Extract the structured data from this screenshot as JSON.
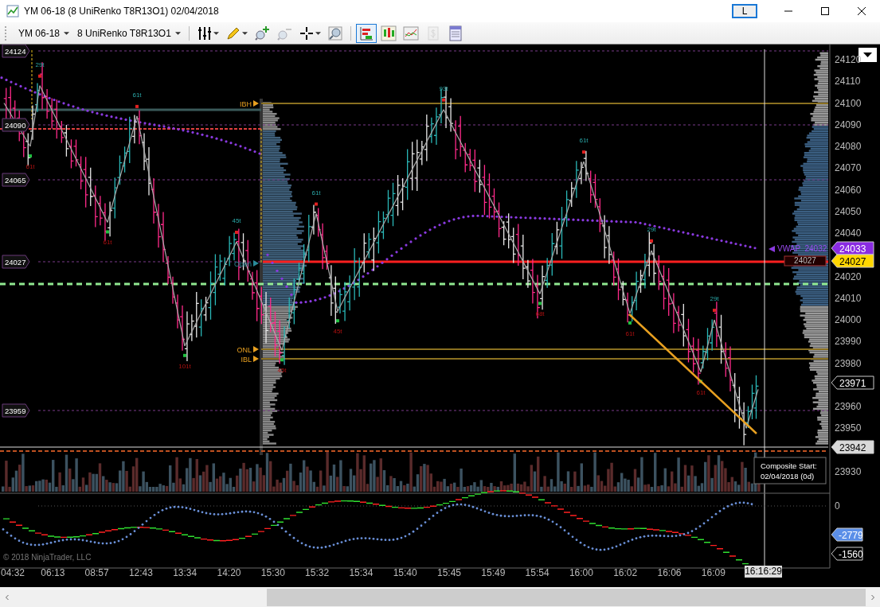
{
  "window": {
    "title": "YM 06-18 (8 UniRenko T8R13O1)  02/04/2018",
    "link_button": "L"
  },
  "toolbar": {
    "instrument": "YM 06-18",
    "bar_type": "8 UniRenko T8R13O1",
    "tools": [
      {
        "kind": "properties",
        "selected": false,
        "disabled": false
      },
      {
        "kind": "pencil",
        "selected": false,
        "disabled": false
      },
      {
        "kind": "zoomin",
        "selected": false,
        "disabled": false
      },
      {
        "kind": "zoomout",
        "selected": false,
        "disabled": true
      },
      {
        "kind": "crosshair",
        "selected": false,
        "disabled": false
      },
      {
        "kind": "magnifier",
        "selected": false,
        "disabled": false
      },
      {
        "kind": "trader",
        "selected": true,
        "disabled": false
      },
      {
        "kind": "candles",
        "selected": false,
        "disabled": false
      },
      {
        "kind": "indicators",
        "selected": false,
        "disabled": false
      },
      {
        "kind": "money",
        "selected": false,
        "disabled": true
      },
      {
        "kind": "databox",
        "selected": false,
        "disabled": false
      }
    ]
  },
  "chart": {
    "price_axis": [
      "24120",
      "24110",
      "24100",
      "24090",
      "24080",
      "24070",
      "24060",
      "24050",
      "24040",
      "24020",
      "24010",
      "24000",
      "23990",
      "23980",
      "23960",
      "23950",
      "23930"
    ],
    "left_tags": [
      "24124",
      "24090",
      "24065",
      "24027",
      "23959"
    ],
    "level_labels": [
      "IBH",
      "Open",
      "ONL",
      "IBL"
    ],
    "swing_labels": [
      "61t",
      "29t",
      "61t",
      "61t",
      "101t",
      "45t",
      "45t",
      "61t",
      "45t",
      "93t",
      "68t",
      "61t",
      "61t",
      "29t",
      "61t",
      "29t"
    ],
    "vwap_label": "VWAP  24032",
    "poc_label": "24027",
    "price_tags": [
      {
        "text": "24033",
        "color": "#8a2be2"
      },
      {
        "text": "24027",
        "color": "#ffd700"
      },
      {
        "text": "23971",
        "color": "#000000"
      },
      {
        "text": "23942",
        "color": "#d9d9d9"
      }
    ],
    "composite": [
      "Composite Start:",
      "02/04/2018 (0d)"
    ],
    "indicator_axis": "0",
    "indicator_tags": [
      {
        "text": "-2779",
        "color": "#5b8fe8"
      },
      {
        "text": "-1560",
        "color": "#000000"
      }
    ],
    "copyright": "© 2018 NinjaTrader, LLC",
    "time_axis": [
      "04:32",
      "06:13",
      "08:57",
      "12:43",
      "13:34",
      "14:20",
      "15:30",
      "15:32",
      "15:34",
      "15:40",
      "15:45",
      "15:49",
      "15:54",
      "16:00",
      "16:02",
      "16:06",
      "16:09"
    ],
    "crosshair_time": "16:16:29"
  }
}
